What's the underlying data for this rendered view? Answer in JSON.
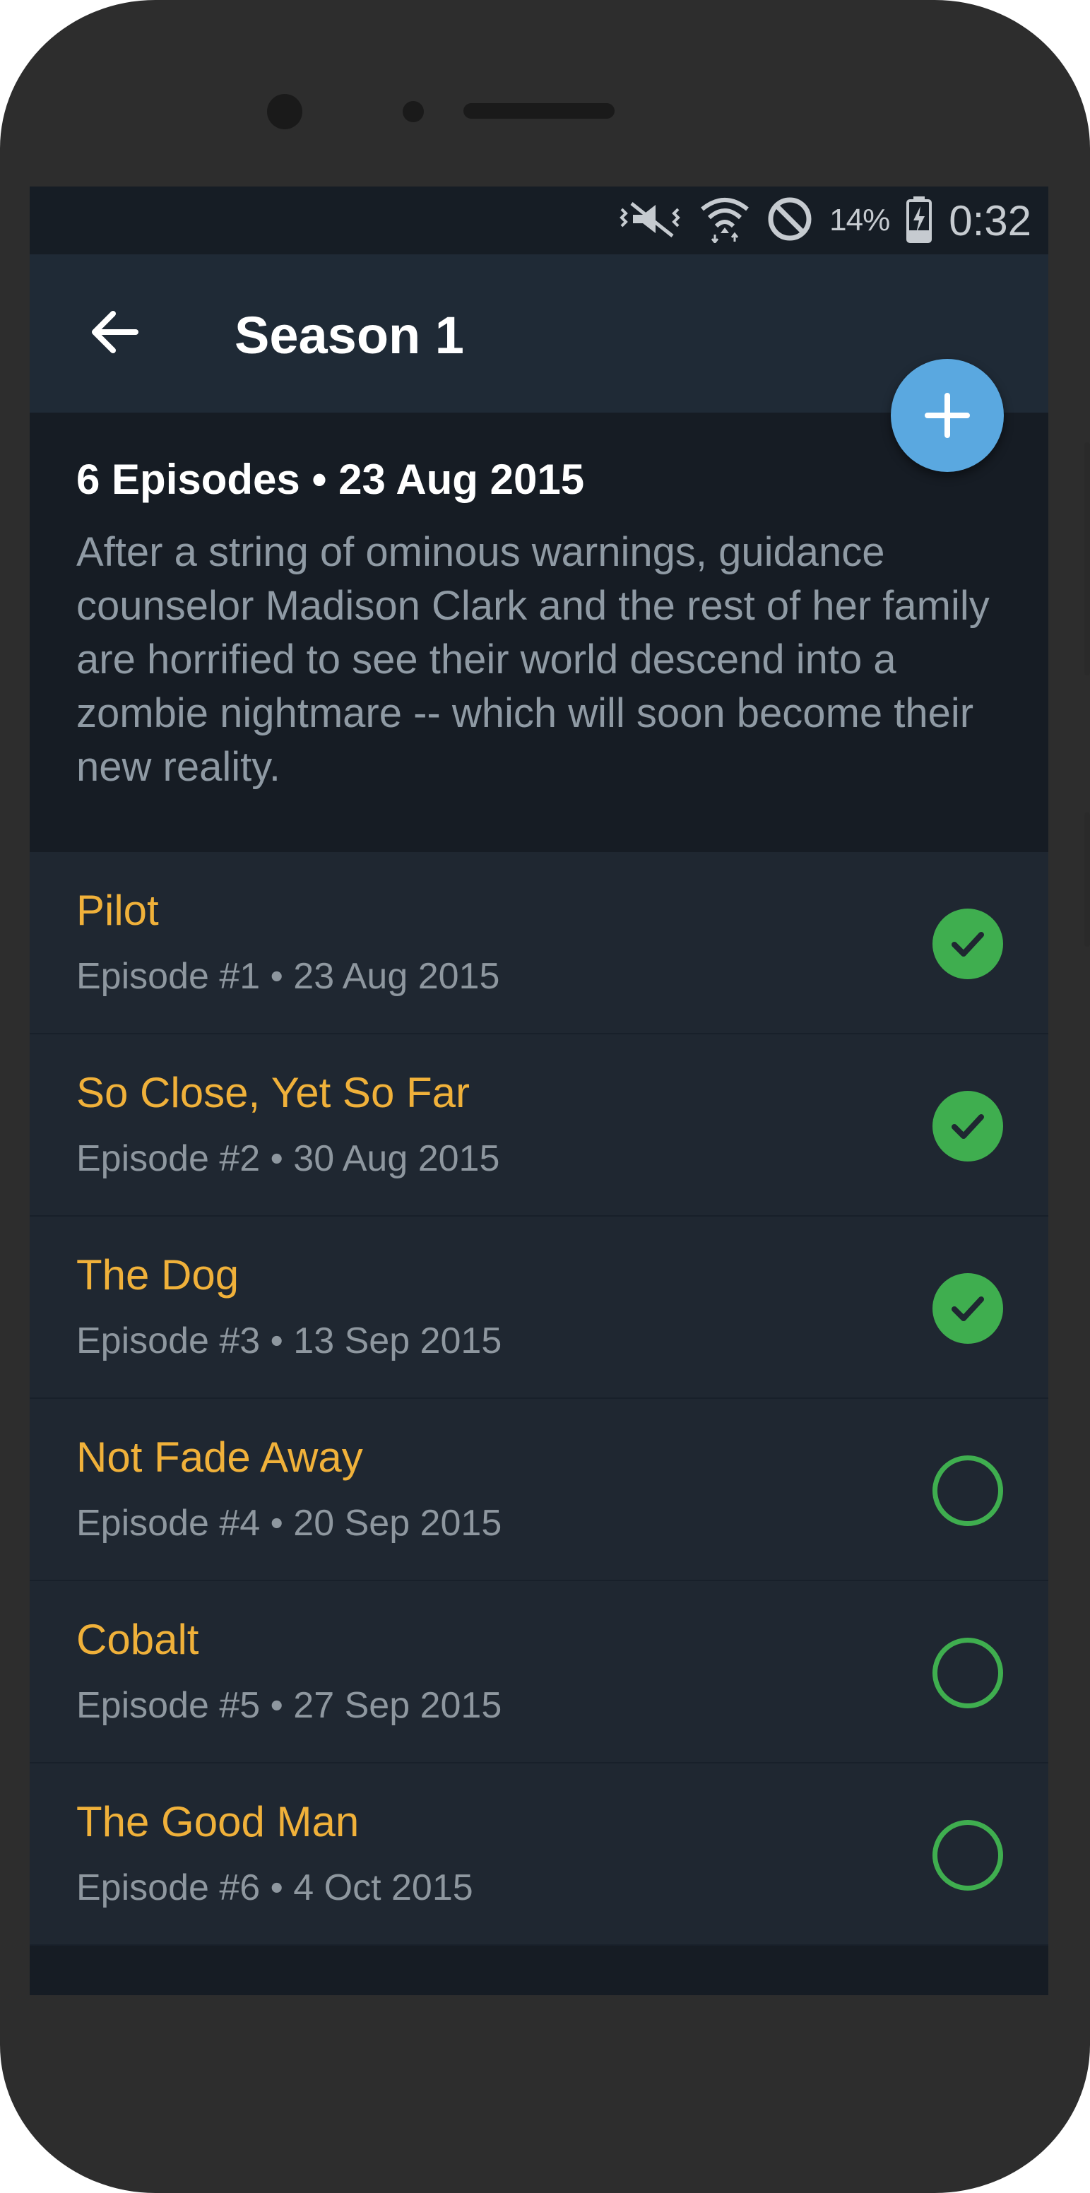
{
  "status_bar": {
    "battery_percent": "14%",
    "time": "0:32"
  },
  "toolbar": {
    "title": "Season 1",
    "back_icon": "arrow-left-icon",
    "add_icon": "plus-icon"
  },
  "summary": {
    "meta": "6 Episodes • 23 Aug 2015",
    "description": "After a string of ominous warnings, guidance counselor Madison Clark and the rest of her family are horrified to see their world descend into a zombie nightmare -- which will soon become their new reality."
  },
  "episodes": [
    {
      "title": "Pilot",
      "subtitle": "Episode #1 • 23 Aug 2015",
      "watched": true
    },
    {
      "title": "So Close, Yet So Far",
      "subtitle": "Episode #2 • 30 Aug 2015",
      "watched": true
    },
    {
      "title": "The Dog",
      "subtitle": "Episode #3 • 13 Sep 2015",
      "watched": true
    },
    {
      "title": "Not Fade Away",
      "subtitle": "Episode #4 • 20 Sep 2015",
      "watched": false
    },
    {
      "title": "Cobalt",
      "subtitle": "Episode #5 • 27 Sep 2015",
      "watched": false
    },
    {
      "title": "The Good Man",
      "subtitle": "Episode #6 • 4 Oct 2015",
      "watched": false
    }
  ],
  "colors": {
    "accent_title": "#f0b13a",
    "watched_green": "#3fae4f",
    "fab_blue": "#5aa8e0"
  }
}
